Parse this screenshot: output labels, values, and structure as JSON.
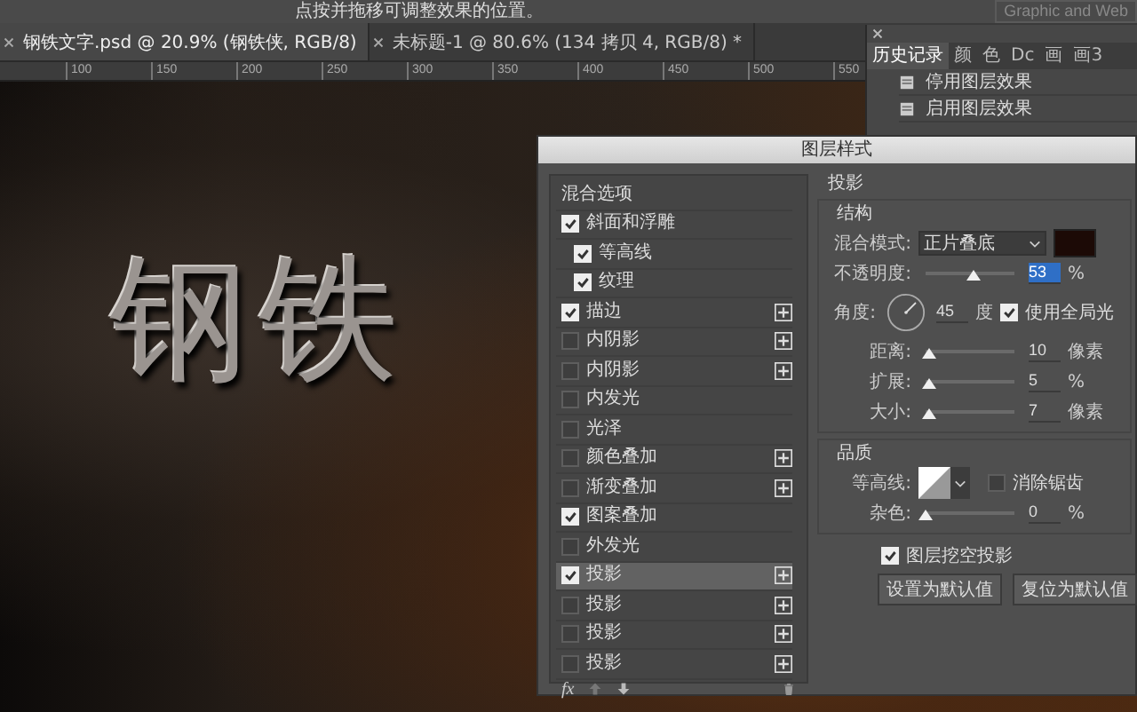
{
  "options_bar": {
    "hint": "点按并拖移可调整效果的位置。",
    "workspace": "Graphic and Web"
  },
  "doc_tabs": [
    {
      "label": "钢铁文字.psd @ 20.9% (钢铁侠, RGB/8)",
      "selected": true
    },
    {
      "label": "未标题-1 @ 80.6% (134 拷贝 4, RGB/8) *",
      "selected": false
    }
  ],
  "ruler": [
    "100",
    "150",
    "200",
    "250",
    "300",
    "350",
    "400",
    "450",
    "500",
    "550"
  ],
  "canvas": {
    "text": "钢铁"
  },
  "history_panel": {
    "tabs": [
      {
        "label": "历史记录",
        "selected": true
      },
      {
        "label": "颜",
        "selected": false
      },
      {
        "label": "色",
        "selected": false
      },
      {
        "label": "Dc",
        "selected": false
      },
      {
        "label": "画",
        "selected": false
      },
      {
        "label": "画3",
        "selected": false
      }
    ],
    "items": [
      "停用图层效果",
      "启用图层效果"
    ]
  },
  "dialog": {
    "title": "图层样式",
    "styles": [
      {
        "label": "混合选项",
        "kind": "header",
        "selected": false
      },
      {
        "label": "斜面和浮雕",
        "kind": "check",
        "checked": true,
        "add": false,
        "selected": false,
        "children": [
          {
            "label": "等高线",
            "kind": "check",
            "checked": true,
            "add": false,
            "selected": false
          },
          {
            "label": "纹理",
            "kind": "check",
            "checked": true,
            "add": false,
            "selected": false
          }
        ]
      },
      {
        "label": "描边",
        "kind": "check",
        "checked": true,
        "add": true,
        "selected": false
      },
      {
        "label": "内阴影",
        "kind": "check",
        "checked": false,
        "add": true,
        "selected": false
      },
      {
        "label": "内阴影",
        "kind": "check",
        "checked": false,
        "add": true,
        "selected": false
      },
      {
        "label": "内发光",
        "kind": "check",
        "checked": false,
        "add": false,
        "selected": false
      },
      {
        "label": "光泽",
        "kind": "check",
        "checked": false,
        "add": false,
        "selected": false
      },
      {
        "label": "颜色叠加",
        "kind": "check",
        "checked": false,
        "add": true,
        "selected": false
      },
      {
        "label": "渐变叠加",
        "kind": "check",
        "checked": false,
        "add": true,
        "selected": false
      },
      {
        "label": "图案叠加",
        "kind": "check",
        "checked": true,
        "add": false,
        "selected": false
      },
      {
        "label": "外发光",
        "kind": "check",
        "checked": false,
        "add": false,
        "selected": false
      },
      {
        "label": "投影",
        "kind": "check",
        "checked": true,
        "add": true,
        "selected": true
      },
      {
        "label": "投影",
        "kind": "check",
        "checked": false,
        "add": true,
        "selected": false
      },
      {
        "label": "投影",
        "kind": "check",
        "checked": false,
        "add": true,
        "selected": false
      },
      {
        "label": "投影",
        "kind": "check",
        "checked": false,
        "add": true,
        "selected": false
      }
    ],
    "footer": {
      "fx": "fx"
    },
    "section": "投影",
    "structure": {
      "title": "结构",
      "blend_label": "混合模式:",
      "blend_mode": "正片叠底",
      "opacity": {
        "label": "不透明度:",
        "level": 0.53,
        "value": "53",
        "unit": "%"
      },
      "angle": {
        "label": "角度:",
        "value": "45",
        "unit": "度",
        "global_light": {
          "label": "使用全局光",
          "checked": true
        }
      },
      "sliders": [
        {
          "label": "距离:",
          "level": 0.03,
          "value": "10",
          "unit": "像素"
        },
        {
          "label": "扩展:",
          "level": 0.03,
          "value": "5",
          "unit": "%"
        },
        {
          "label": "大小:",
          "level": 0.03,
          "value": "7",
          "unit": "像素"
        }
      ]
    },
    "quality": {
      "title": "品质",
      "contour_label": "等高线:",
      "antialias": {
        "label": "消除锯齿",
        "checked": false
      },
      "noise": {
        "label": "杂色:",
        "level": 0,
        "value": "0",
        "unit": "%"
      }
    },
    "knockout": {
      "label": "图层挖空投影",
      "checked": true
    },
    "buttons": [
      "设置为默认值",
      "复位为默认值"
    ]
  }
}
